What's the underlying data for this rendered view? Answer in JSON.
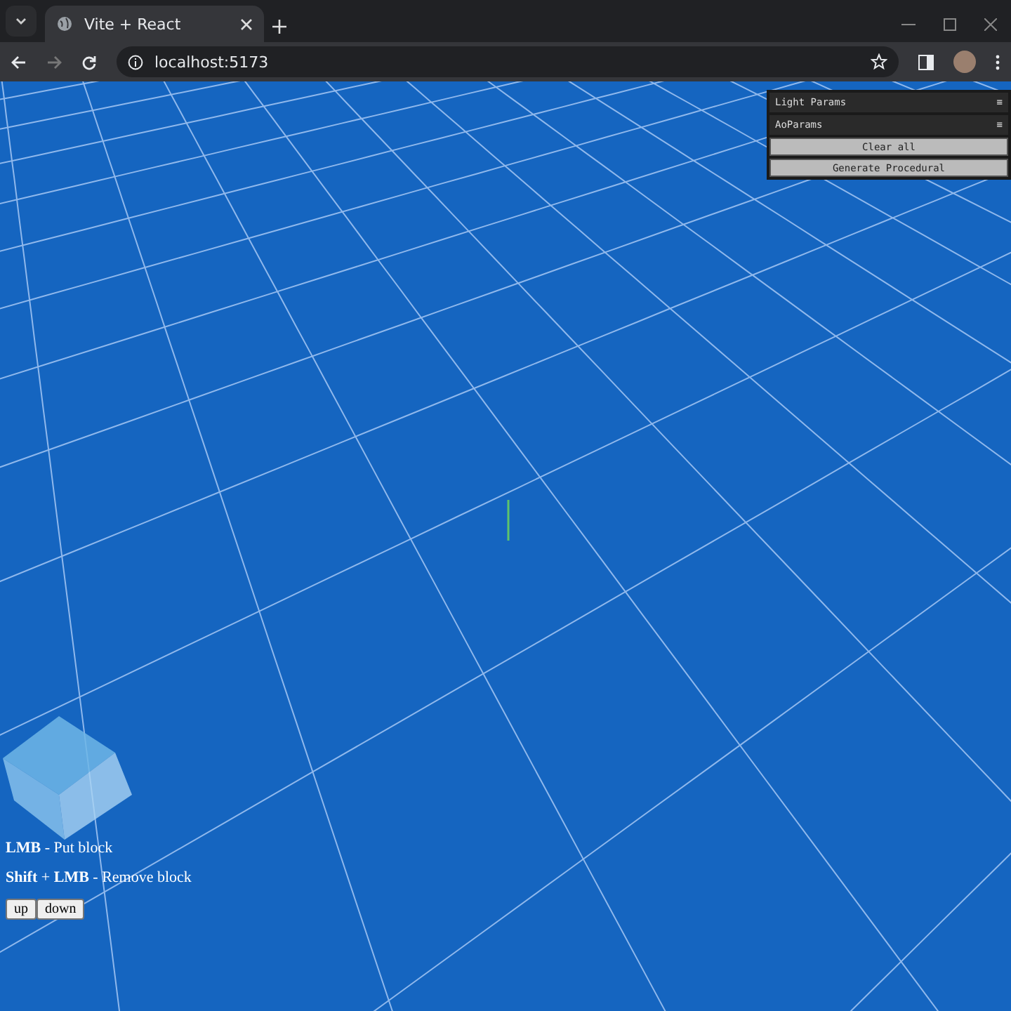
{
  "browser": {
    "tabs": [
      {
        "title": "Vite + React",
        "selected": true
      }
    ],
    "address": "localhost:5173"
  },
  "gui_panel": {
    "folders": [
      {
        "label": "Light Params",
        "icon": "≡"
      },
      {
        "label": "AoParams",
        "icon": "≡"
      }
    ],
    "buttons": [
      "Clear all",
      "Generate Procedural"
    ]
  },
  "help": [
    "**LMB** - Put block",
    "**Shift** + **LMB** - Remove block"
  ],
  "controls": [
    "up",
    "down"
  ]
}
